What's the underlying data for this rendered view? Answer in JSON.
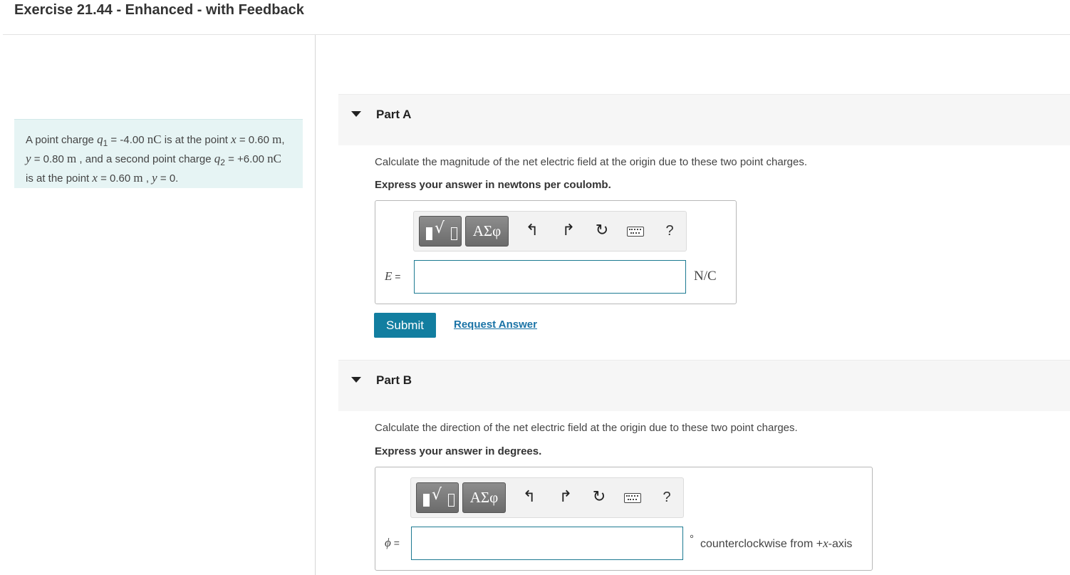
{
  "header": {
    "title": "Exercise 21.44 - Enhanced - with Feedback"
  },
  "problem": {
    "t1": "A point charge ",
    "q1_sym": "q",
    "q1_sub": "1",
    "t2": " = -4.00 ",
    "nC1": "nC",
    "t3": " is at the point ",
    "x_sym1": "x",
    "t4": " = 0.60 ",
    "m1": "m",
    "t5": ", ",
    "y_sym1": "y",
    "t6": " = 0.80 ",
    "m2": "m",
    "t7": " , and a second point charge ",
    "q2_sym": "q",
    "q2_sub": "2",
    "t8": " = +6.00 ",
    "nC2": "nC",
    "t9": " is at the point ",
    "x_sym2": "x",
    "t10": " = 0.60 ",
    "m3": "m",
    "t11": " , ",
    "y_sym2": "y",
    "t12": " = 0."
  },
  "toolbar": {
    "greek_label": "ΑΣφ",
    "undo_icon": "undo-arrow",
    "redo_icon": "redo-arrow",
    "reset_icon": "reset-circle",
    "keyboard_icon": "keyboard",
    "help_label": "?"
  },
  "partA": {
    "title": "Part A",
    "prompt": "Calculate the magnitude of the net electric field at the origin due to these two point charges.",
    "instruction": "Express your answer in newtons per coulomb.",
    "var_sym": "E",
    "var_eq": " =",
    "input_value": "",
    "unit": "N/C",
    "submit_label": "Submit",
    "request_label": "Request Answer"
  },
  "partB": {
    "title": "Part B",
    "prompt": "Calculate the direction of the net electric field at the origin due to these two point charges.",
    "instruction": "Express your answer in degrees.",
    "var_sym": "ϕ",
    "var_eq": " =",
    "input_value": "",
    "degree_symbol": "°",
    "unit_pre": "counterclockwise from +",
    "unit_axis": "x",
    "unit_post": "-axis"
  },
  "colors": {
    "accent": "#127ea0",
    "link": "#1a73a6",
    "problem_bg": "#e6f4f4",
    "input_border": "#1d7a92"
  }
}
